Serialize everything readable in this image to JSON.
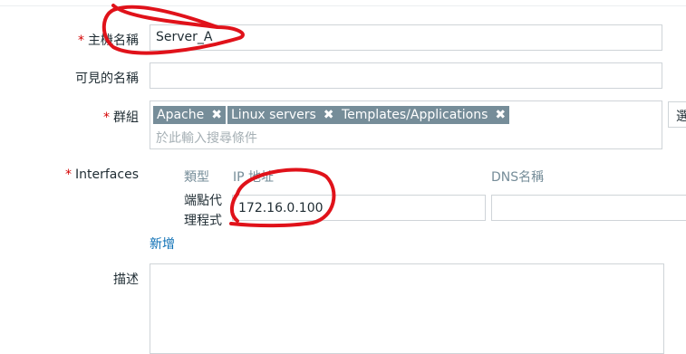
{
  "form": {
    "host_name": {
      "label": "主機名稱",
      "value": "Server_A",
      "required": "*"
    },
    "visible_name": {
      "label": "可見的名稱",
      "value": ""
    },
    "groups": {
      "label": "群組",
      "required": "*",
      "tags": [
        "Apache",
        "Linux servers",
        "Templates/Applications"
      ],
      "remove_glyph": "✖",
      "placeholder": "於此輸入搜尋條件",
      "select_button": "選擇"
    },
    "interfaces": {
      "label": "Interfaces",
      "required": "*",
      "columns": {
        "type": "類型",
        "ip": "IP 地址",
        "dns": "DNS名稱"
      },
      "row": {
        "type": "端點代\n理程式",
        "ip": "172.16.0.100",
        "dns": ""
      },
      "add_link": "新增"
    },
    "description": {
      "label": "描述",
      "value": ""
    }
  },
  "colors": {
    "required_star": "#d40000",
    "tag_bg": "#768d99",
    "link": "#0a6eb4",
    "annotation": "#e0121a"
  }
}
